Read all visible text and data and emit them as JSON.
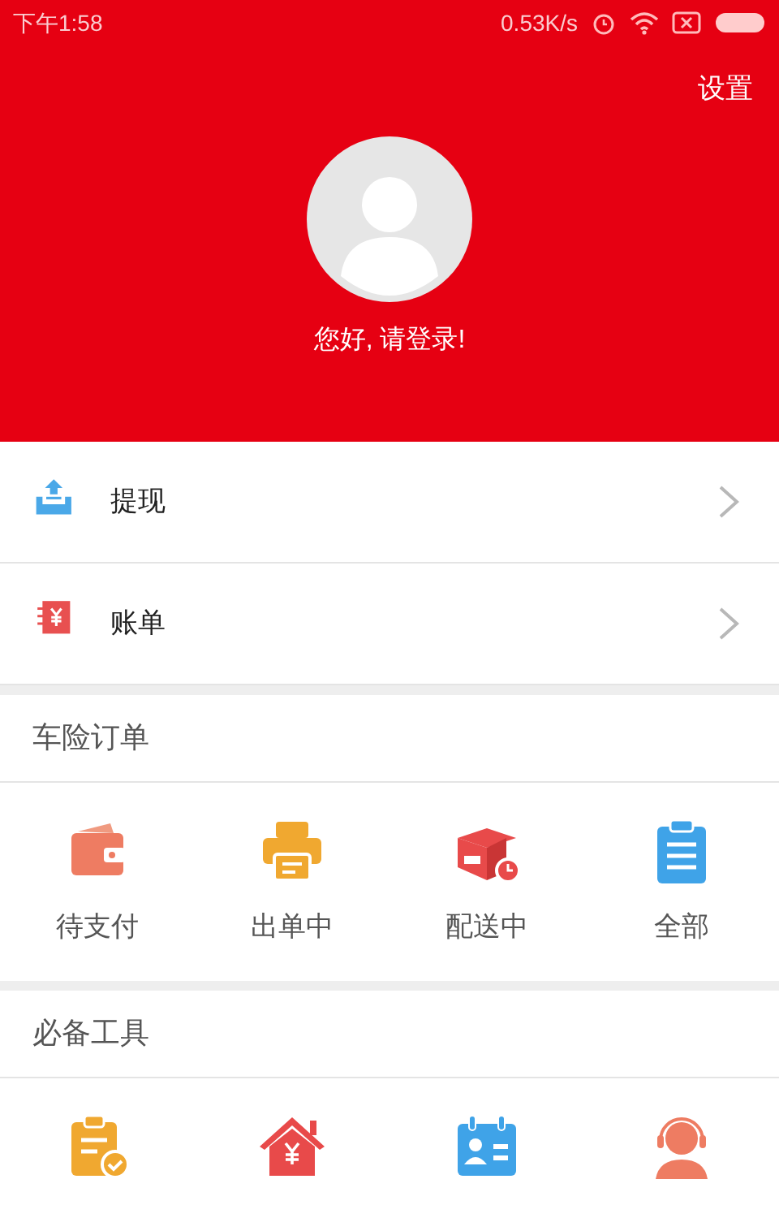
{
  "status_bar": {
    "time": "下午1:58",
    "speed": "0.53K/s"
  },
  "header": {
    "settings": "设置",
    "greeting": "您好, 请登录!"
  },
  "menu": [
    {
      "kind": "withdraw",
      "label": "提现"
    },
    {
      "kind": "bill",
      "label": "账单"
    }
  ],
  "sections": [
    {
      "title": "车险订单",
      "items": [
        {
          "kind": "wallet",
          "label": "待支付"
        },
        {
          "kind": "printer",
          "label": "出单中"
        },
        {
          "kind": "box",
          "label": "配送中"
        },
        {
          "kind": "clipboard",
          "label": "全部"
        }
      ]
    },
    {
      "title": "必备工具",
      "items": [
        {
          "kind": "task"
        },
        {
          "kind": "house"
        },
        {
          "kind": "card"
        },
        {
          "kind": "support"
        }
      ]
    }
  ]
}
